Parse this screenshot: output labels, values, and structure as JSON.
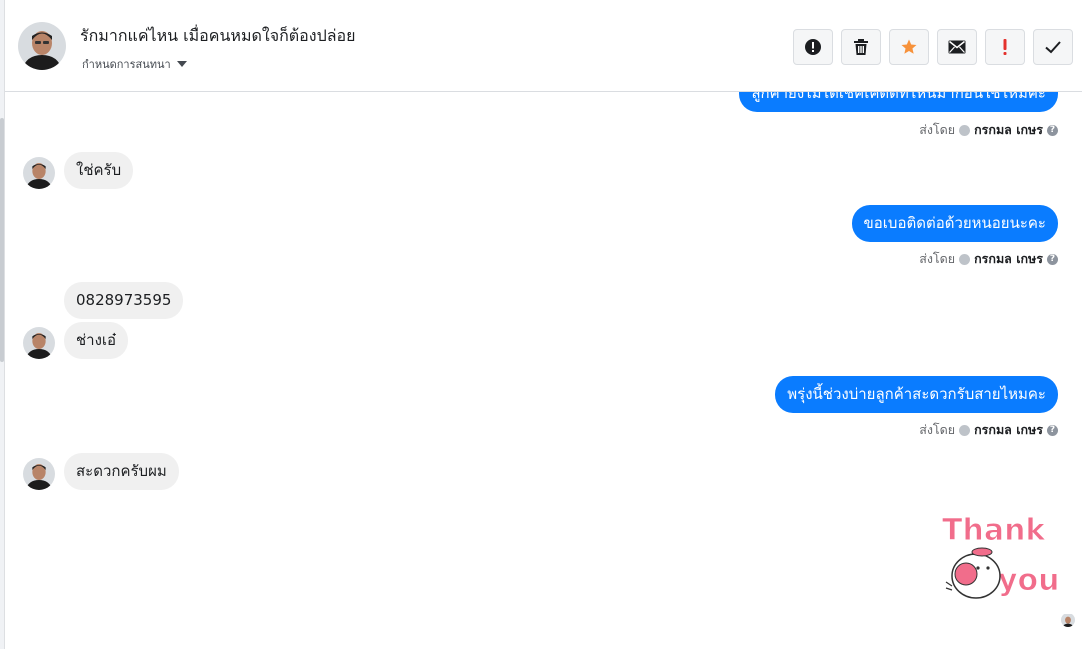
{
  "conversation": {
    "title": "รักมากแค่ไหน เมื่อคนหมดใจก็ต้องปล่อย",
    "subtitle": "กำหนดการสนทนา"
  },
  "header_actions": [
    {
      "name": "report-icon",
      "tooltip": ""
    },
    {
      "name": "trash-icon",
      "tooltip": ""
    },
    {
      "name": "star-icon",
      "tooltip": ""
    },
    {
      "name": "mail-icon",
      "tooltip": ""
    },
    {
      "name": "important-icon",
      "tooltip": ""
    },
    {
      "name": "check-icon",
      "tooltip": ""
    }
  ],
  "messages": {
    "m0": {
      "text": "ลูกค้ายังไม่ได้เช็คเค้ดดีที่ไหนมาก่อนใช่ไหมคะ",
      "sent_prefix": "ส่งโดย",
      "sender": "กรกมล เกษร"
    },
    "m1": {
      "text": "ใช่ครับ"
    },
    "m2": {
      "text": "ขอเบอติดต่อด้วยหนอยนะคะ",
      "sent_prefix": "ส่งโดย",
      "sender": "กรกมล เกษร"
    },
    "m3": {
      "text": "0828973595"
    },
    "m4": {
      "text": "ช่างเอ๋"
    },
    "m5": {
      "text": "พรุ่งนี้ช่วงบ่ายลูกค้าสะดวกรับสายไหมคะ",
      "sent_prefix": "ส่งโดย",
      "sender": "กรกมล เกษร"
    },
    "m6": {
      "text": "สะดวกครับผม"
    }
  },
  "sticker": {
    "line1": "Thank",
    "line2": "you"
  },
  "colors": {
    "accent": "#0a7cff",
    "incoming_bubble": "#f0f0f0",
    "star": "#f7923b",
    "important": "#e4312c",
    "sticker_text": "#f16d8b"
  }
}
